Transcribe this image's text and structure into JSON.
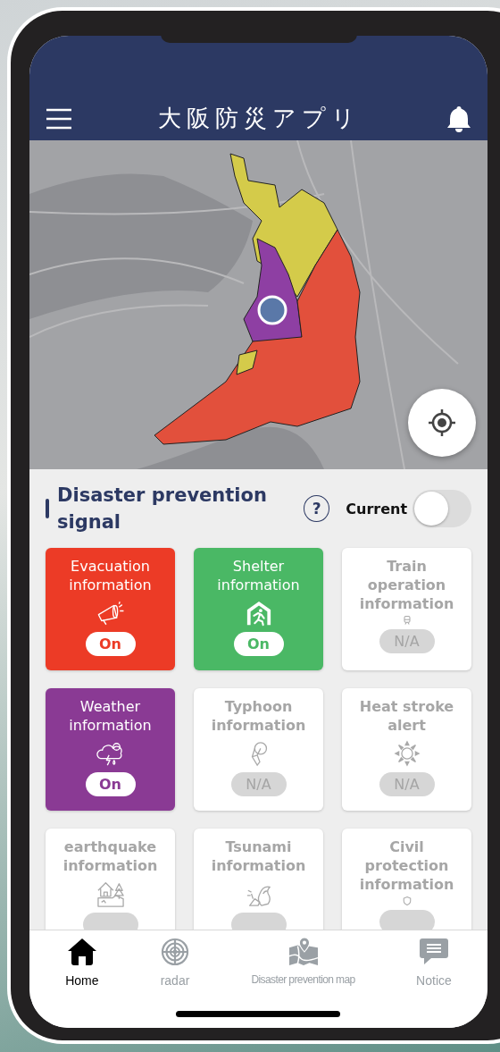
{
  "header": {
    "title": "大阪防災アプリ"
  },
  "signal_section": {
    "title": "Disaster prevention signal",
    "help": "?",
    "current_label": "Current",
    "current_on": false
  },
  "signals": [
    {
      "label": "Evacuation information",
      "status": "On",
      "active": true,
      "color": "#ec3b26"
    },
    {
      "label": "Shelter information",
      "status": "On",
      "active": true,
      "color": "#4ab865"
    },
    {
      "label": "Train operation information",
      "status": "N/A",
      "active": false
    },
    {
      "label": "Weather information",
      "status": "On",
      "active": true,
      "color": "#8a3a94"
    },
    {
      "label": "Typhoon information",
      "status": "N/A",
      "active": false
    },
    {
      "label": "Heat stroke alert",
      "status": "N/A",
      "active": false
    },
    {
      "label": "earthquake information",
      "active": false
    },
    {
      "label": "Tsunami information",
      "active": false
    },
    {
      "label": "Civil protection information",
      "active": false
    }
  ],
  "tab_bar": [
    {
      "label": "Home",
      "selected": true
    },
    {
      "label": "radar",
      "selected": false
    },
    {
      "label": "Disaster prevention map",
      "selected": false
    },
    {
      "label": "Notice",
      "selected": false
    }
  ]
}
